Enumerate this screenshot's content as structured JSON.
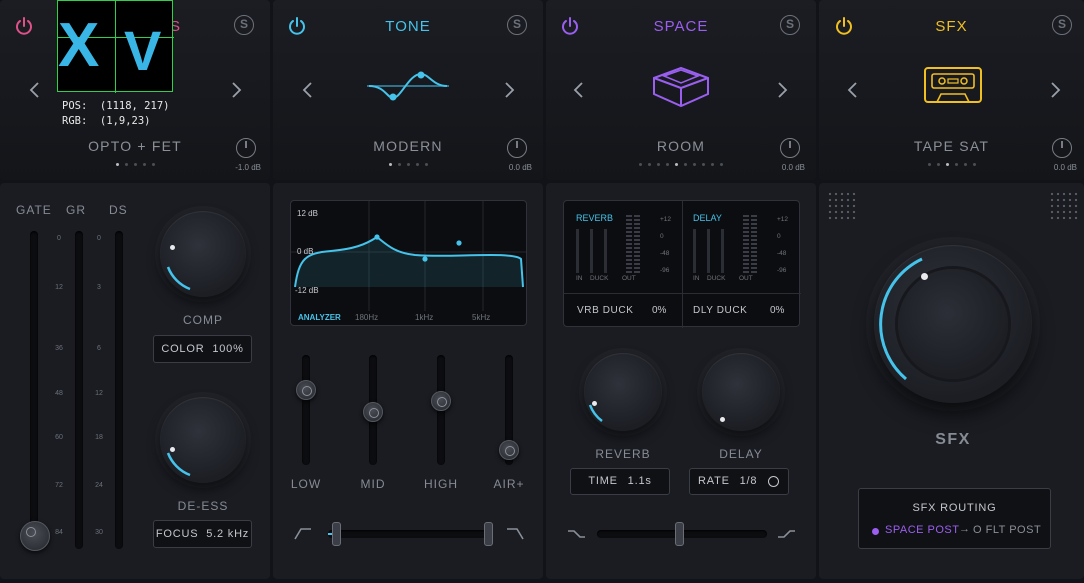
{
  "modules": [
    {
      "id": "dyn",
      "title": "S",
      "color": "#e0508a",
      "preset": "OPTO + FET",
      "value": "-1.0 dB"
    },
    {
      "id": "tone",
      "title": "TONE",
      "color": "#45c3ea",
      "preset": "MODERN",
      "value": "0.0 dB"
    },
    {
      "id": "space",
      "title": "SPACE",
      "color": "#9a5ff0",
      "preset": "ROOM",
      "value": "0.0 dB"
    },
    {
      "id": "sfx",
      "title": "SFX",
      "color": "#f0c020",
      "preset": "TAPE SAT",
      "value": "0.0 dB"
    }
  ],
  "overlay": {
    "glyph1": "X",
    "glyph2": "V",
    "pos": "POS:  (1118, 217)",
    "rgb": "RGB:  (1,9,23)"
  },
  "solo_glyph": "S",
  "dynamics": {
    "meter_labels": [
      "GATE",
      "GR",
      "DS"
    ],
    "gate_ticks": [
      "0",
      "12",
      "36",
      "48",
      "60",
      "72",
      "84"
    ],
    "gr_ticks": [
      "0",
      "3",
      "6",
      "12",
      "18",
      "24",
      "30"
    ],
    "comp_label": "COMP",
    "color_box": {
      "label": "COLOR",
      "value": "100%"
    },
    "deess_label": "DE-ESS",
    "focus_box": {
      "label": "FOCUS",
      "value": "5.2 kHz"
    }
  },
  "eq": {
    "db_labels": [
      "12 dB",
      "0 dB",
      "-12 dB"
    ],
    "analyzer": "ANALYZER",
    "freq_labels": [
      "180Hz",
      "1kHz",
      "5kHz"
    ],
    "bands": [
      {
        "name": "LOW",
        "level": 0.72
      },
      {
        "name": "MID",
        "level": 0.48
      },
      {
        "name": "HIGH",
        "level": 0.6
      },
      {
        "name": "AIR+",
        "level": 0.06
      }
    ]
  },
  "space": {
    "reverb_title": "REVERB",
    "delay_title": "DELAY",
    "scale": [
      "+12",
      "0",
      "-48",
      "-96"
    ],
    "meter_cols": [
      "IN",
      "DUCK",
      "OUT"
    ],
    "vrb_duck": {
      "label": "VRB DUCK",
      "value": "0%"
    },
    "dly_duck": {
      "label": "DLY DUCK",
      "value": "0%"
    },
    "reverb_label": "REVERB",
    "delay_label": "DELAY",
    "time_box": {
      "label": "TIME",
      "value": "1.1s"
    },
    "rate_box": {
      "label": "RATE",
      "value": "1/8"
    }
  },
  "sfx": {
    "label": "SFX",
    "routing_title": "SFX ROUTING",
    "route_a": "SPACE POST",
    "route_b": "O FLT POST",
    "accent": "#9a5ff0"
  }
}
